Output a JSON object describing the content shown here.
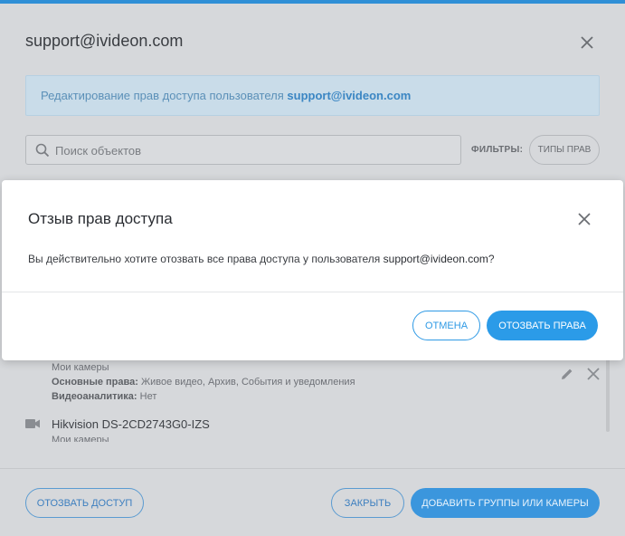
{
  "background_dialog": {
    "title": "support@ivideon.com",
    "info": {
      "text": "Редактирование прав доступа пользователя",
      "email": "support@ivideon.com"
    },
    "search": {
      "placeholder": "Поиск объектов",
      "value": ""
    },
    "filters": {
      "label": "ФИЛЬТРЫ:",
      "button_label": "ТИПЫ ПРАВ"
    },
    "list": {
      "item1": {
        "group": "Мои камеры",
        "main_rights_label": "Основные права:",
        "main_rights_value": "Живое видео, Архив, События и уведомления",
        "analytics_label": "Видеоаналитика:",
        "analytics_value": "Нет"
      },
      "item2": {
        "name": "Hikvision DS-2CD2743G0-IZS",
        "group": "Мои камеры"
      }
    },
    "footer": {
      "revoke_label": "ОТОЗВАТЬ ДОСТУП",
      "close_label": "ЗАКРЫТЬ",
      "add_label": "ДОБАВИТЬ ГРУППЫ ИЛИ КАМЕРЫ"
    }
  },
  "modal": {
    "title": "Отзыв прав доступа",
    "message_prefix": "Вы действительно хотите отозвать все права доступа у пользователя",
    "message_email": "support@ivideon.com",
    "message_suffix": "?",
    "cancel_label": "ОТМЕНА",
    "confirm_label": "ОТОЗВАТЬ ПРАВА"
  },
  "icons": {
    "close": "close-icon",
    "search": "search-icon",
    "camera": "camera-icon",
    "edit": "pencil-icon",
    "remove": "close-icon"
  },
  "colors": {
    "accent": "#2b9be8",
    "info_background": "#c9dce9",
    "top_strip": "#2f8fd6"
  }
}
